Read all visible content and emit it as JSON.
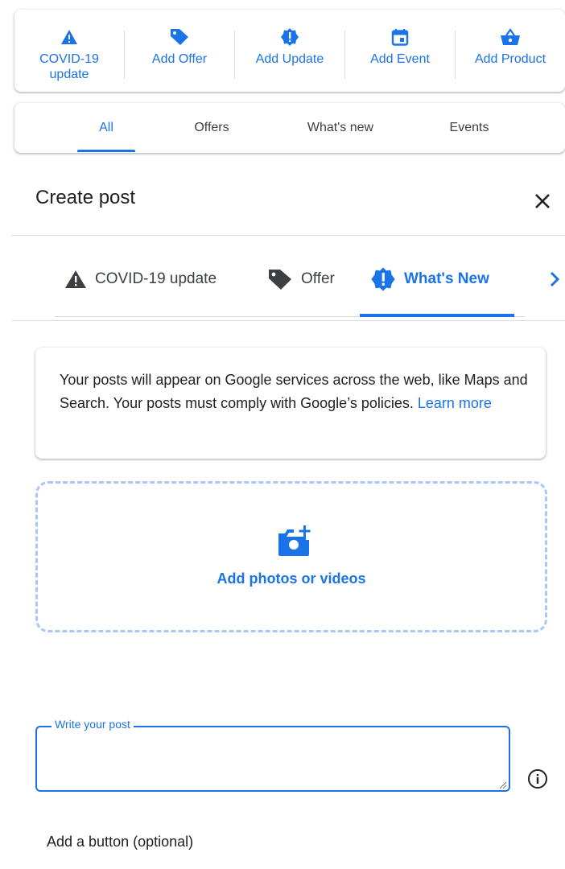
{
  "actions": [
    {
      "icon": "warning-icon",
      "label_line1": "COVID-19",
      "label_line2": "update"
    },
    {
      "icon": "tag-icon",
      "label": "Add Offer"
    },
    {
      "icon": "update-badge-icon",
      "label": "Add Update"
    },
    {
      "icon": "calendar-icon",
      "label": "Add Event"
    },
    {
      "icon": "basket-icon",
      "label": "Add Product"
    }
  ],
  "filter_tabs": [
    {
      "label": "All",
      "active": true
    },
    {
      "label": "Offers"
    },
    {
      "label": "What's new"
    },
    {
      "label": "Events"
    }
  ],
  "dialog": {
    "title": "Create post",
    "close_icon": "close-icon",
    "post_tabs": [
      {
        "icon": "warning-icon",
        "label": "COVID-19 update"
      },
      {
        "icon": "tag-icon",
        "label": "Offer"
      },
      {
        "icon": "update-badge-icon",
        "label": "What's New",
        "active": true
      }
    ],
    "next_icon": "chevron-right-icon",
    "info": {
      "text": "Your posts will appear on Google services across the web, like Maps and Search. Your posts must comply with Google’s policies. ",
      "link": "Learn more"
    },
    "media": {
      "icon": "add-photo-icon",
      "label": "Add photos or videos"
    },
    "post_field": {
      "label": "Write your post",
      "value": ""
    },
    "info_icon": "info-icon",
    "add_button_label": "Add a button (optional)"
  },
  "colors": {
    "accent": "#1a73e8",
    "text": "#202124",
    "muted": "#3c4043",
    "divider": "#dadce0",
    "dash": "#a8c7fa"
  }
}
